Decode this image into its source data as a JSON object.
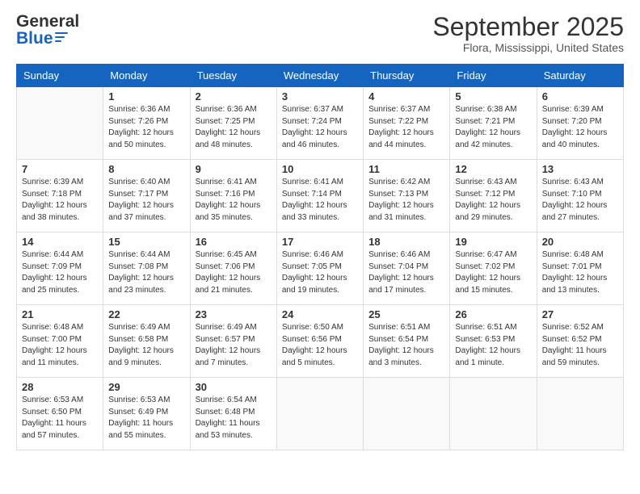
{
  "header": {
    "logo_general": "General",
    "logo_blue": "Blue",
    "title": "September 2025",
    "subtitle": "Flora, Mississippi, United States"
  },
  "columns": [
    "Sunday",
    "Monday",
    "Tuesday",
    "Wednesday",
    "Thursday",
    "Friday",
    "Saturday"
  ],
  "weeks": [
    [
      {
        "day": "",
        "info": ""
      },
      {
        "day": "1",
        "info": "Sunrise: 6:36 AM\nSunset: 7:26 PM\nDaylight: 12 hours\nand 50 minutes."
      },
      {
        "day": "2",
        "info": "Sunrise: 6:36 AM\nSunset: 7:25 PM\nDaylight: 12 hours\nand 48 minutes."
      },
      {
        "day": "3",
        "info": "Sunrise: 6:37 AM\nSunset: 7:24 PM\nDaylight: 12 hours\nand 46 minutes."
      },
      {
        "day": "4",
        "info": "Sunrise: 6:37 AM\nSunset: 7:22 PM\nDaylight: 12 hours\nand 44 minutes."
      },
      {
        "day": "5",
        "info": "Sunrise: 6:38 AM\nSunset: 7:21 PM\nDaylight: 12 hours\nand 42 minutes."
      },
      {
        "day": "6",
        "info": "Sunrise: 6:39 AM\nSunset: 7:20 PM\nDaylight: 12 hours\nand 40 minutes."
      }
    ],
    [
      {
        "day": "7",
        "info": "Sunrise: 6:39 AM\nSunset: 7:18 PM\nDaylight: 12 hours\nand 38 minutes."
      },
      {
        "day": "8",
        "info": "Sunrise: 6:40 AM\nSunset: 7:17 PM\nDaylight: 12 hours\nand 37 minutes."
      },
      {
        "day": "9",
        "info": "Sunrise: 6:41 AM\nSunset: 7:16 PM\nDaylight: 12 hours\nand 35 minutes."
      },
      {
        "day": "10",
        "info": "Sunrise: 6:41 AM\nSunset: 7:14 PM\nDaylight: 12 hours\nand 33 minutes."
      },
      {
        "day": "11",
        "info": "Sunrise: 6:42 AM\nSunset: 7:13 PM\nDaylight: 12 hours\nand 31 minutes."
      },
      {
        "day": "12",
        "info": "Sunrise: 6:43 AM\nSunset: 7:12 PM\nDaylight: 12 hours\nand 29 minutes."
      },
      {
        "day": "13",
        "info": "Sunrise: 6:43 AM\nSunset: 7:10 PM\nDaylight: 12 hours\nand 27 minutes."
      }
    ],
    [
      {
        "day": "14",
        "info": "Sunrise: 6:44 AM\nSunset: 7:09 PM\nDaylight: 12 hours\nand 25 minutes."
      },
      {
        "day": "15",
        "info": "Sunrise: 6:44 AM\nSunset: 7:08 PM\nDaylight: 12 hours\nand 23 minutes."
      },
      {
        "day": "16",
        "info": "Sunrise: 6:45 AM\nSunset: 7:06 PM\nDaylight: 12 hours\nand 21 minutes."
      },
      {
        "day": "17",
        "info": "Sunrise: 6:46 AM\nSunset: 7:05 PM\nDaylight: 12 hours\nand 19 minutes."
      },
      {
        "day": "18",
        "info": "Sunrise: 6:46 AM\nSunset: 7:04 PM\nDaylight: 12 hours\nand 17 minutes."
      },
      {
        "day": "19",
        "info": "Sunrise: 6:47 AM\nSunset: 7:02 PM\nDaylight: 12 hours\nand 15 minutes."
      },
      {
        "day": "20",
        "info": "Sunrise: 6:48 AM\nSunset: 7:01 PM\nDaylight: 12 hours\nand 13 minutes."
      }
    ],
    [
      {
        "day": "21",
        "info": "Sunrise: 6:48 AM\nSunset: 7:00 PM\nDaylight: 12 hours\nand 11 minutes."
      },
      {
        "day": "22",
        "info": "Sunrise: 6:49 AM\nSunset: 6:58 PM\nDaylight: 12 hours\nand 9 minutes."
      },
      {
        "day": "23",
        "info": "Sunrise: 6:49 AM\nSunset: 6:57 PM\nDaylight: 12 hours\nand 7 minutes."
      },
      {
        "day": "24",
        "info": "Sunrise: 6:50 AM\nSunset: 6:56 PM\nDaylight: 12 hours\nand 5 minutes."
      },
      {
        "day": "25",
        "info": "Sunrise: 6:51 AM\nSunset: 6:54 PM\nDaylight: 12 hours\nand 3 minutes."
      },
      {
        "day": "26",
        "info": "Sunrise: 6:51 AM\nSunset: 6:53 PM\nDaylight: 12 hours\nand 1 minute."
      },
      {
        "day": "27",
        "info": "Sunrise: 6:52 AM\nSunset: 6:52 PM\nDaylight: 11 hours\nand 59 minutes."
      }
    ],
    [
      {
        "day": "28",
        "info": "Sunrise: 6:53 AM\nSunset: 6:50 PM\nDaylight: 11 hours\nand 57 minutes."
      },
      {
        "day": "29",
        "info": "Sunrise: 6:53 AM\nSunset: 6:49 PM\nDaylight: 11 hours\nand 55 minutes."
      },
      {
        "day": "30",
        "info": "Sunrise: 6:54 AM\nSunset: 6:48 PM\nDaylight: 11 hours\nand 53 minutes."
      },
      {
        "day": "",
        "info": ""
      },
      {
        "day": "",
        "info": ""
      },
      {
        "day": "",
        "info": ""
      },
      {
        "day": "",
        "info": ""
      }
    ]
  ]
}
